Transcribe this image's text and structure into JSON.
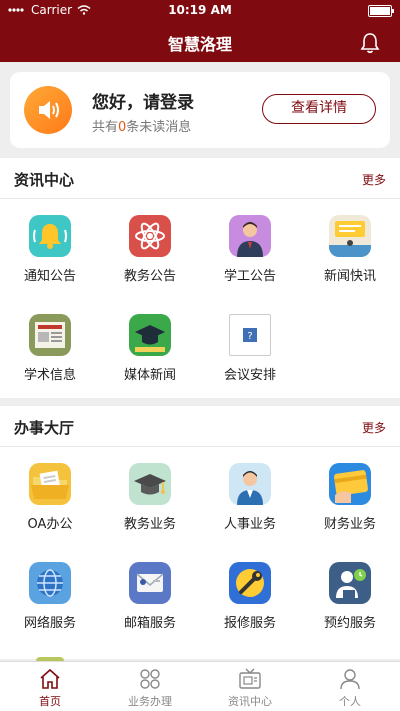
{
  "status": {
    "carrier": "Carrier",
    "time": "10:19 AM"
  },
  "header": {
    "title": "智慧洛理",
    "bell_icon": "bell-icon"
  },
  "login": {
    "greeting": "您好，请登录",
    "unread_prefix": "共有",
    "unread_count": "0",
    "unread_suffix": "条未读消息",
    "detail_label": "查看详情"
  },
  "news": {
    "title": "资讯中心",
    "more": "更多",
    "items": [
      {
        "label": "通知公告",
        "icon": "bell-notice-icon"
      },
      {
        "label": "教务公告",
        "icon": "atom-icon"
      },
      {
        "label": "学工公告",
        "icon": "person-icon"
      },
      {
        "label": "新闻快讯",
        "icon": "news-desk-icon"
      },
      {
        "label": "学术信息",
        "icon": "newspaper-icon"
      },
      {
        "label": "媒体新闻",
        "icon": "graduation-cap-icon"
      },
      {
        "label": "会议安排",
        "icon": "broken-image-icon"
      }
    ]
  },
  "services": {
    "title": "办事大厅",
    "more": "更多",
    "items": [
      {
        "label": "OA办公",
        "icon": "folder-icon"
      },
      {
        "label": "教务业务",
        "icon": "mortarboard-icon"
      },
      {
        "label": "人事业务",
        "icon": "staff-icon"
      },
      {
        "label": "财务业务",
        "icon": "credit-card-icon"
      },
      {
        "label": "网络服务",
        "icon": "globe-icon"
      },
      {
        "label": "邮箱服务",
        "icon": "mail-icon"
      },
      {
        "label": "报修服务",
        "icon": "wrench-icon"
      },
      {
        "label": "预约服务",
        "icon": "appointment-icon"
      }
    ]
  },
  "tabs": [
    {
      "label": "首页",
      "icon": "home-icon",
      "active": true
    },
    {
      "label": "业务办理",
      "icon": "grid-icon",
      "active": false
    },
    {
      "label": "资讯中心",
      "icon": "tv-icon",
      "active": false
    },
    {
      "label": "个人",
      "icon": "user-icon",
      "active": false
    }
  ],
  "colors": {
    "brand": "#7f0b10",
    "accent": "#e35a1a"
  }
}
